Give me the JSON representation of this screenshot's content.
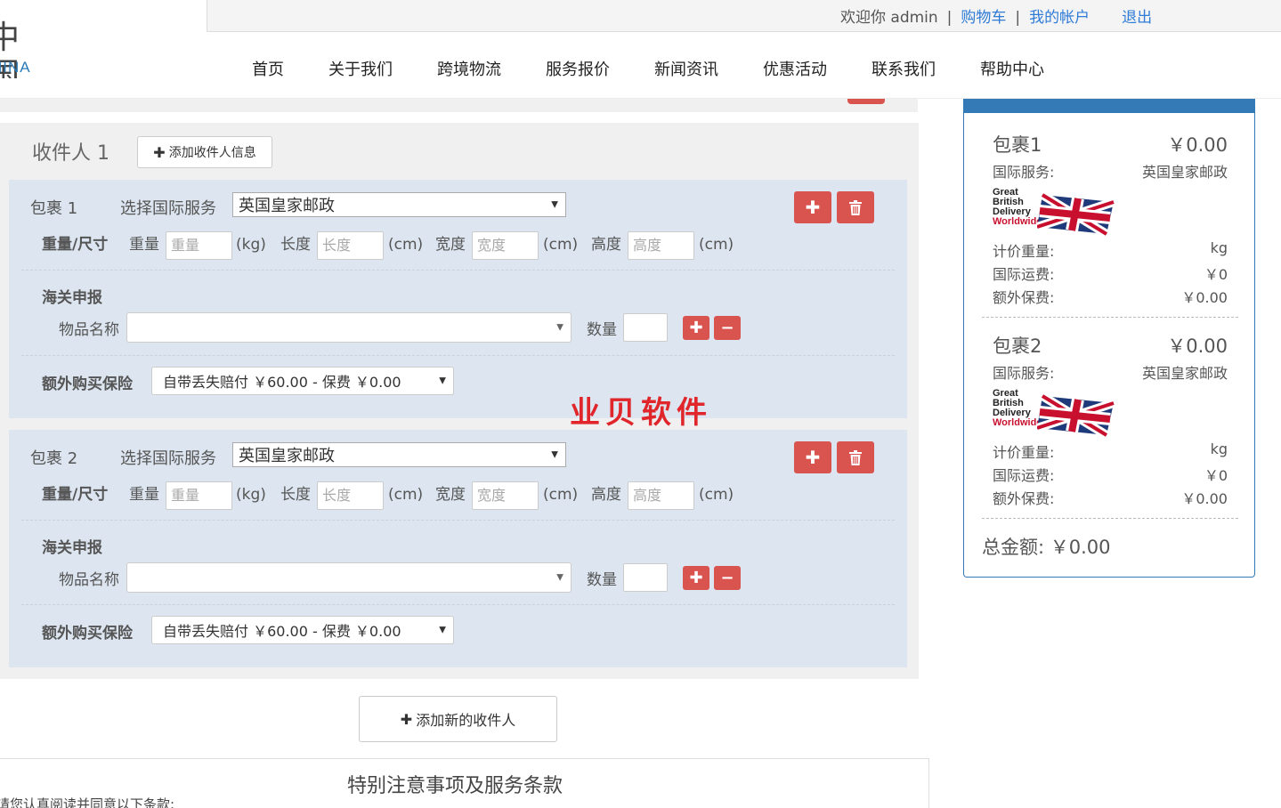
{
  "header": {
    "logo_cn": "中国",
    "logo_en": "HINA",
    "welcome": "欢迎你 admin",
    "cart": "购物车",
    "account": "我的帐户",
    "logout": "退出",
    "sep": "|"
  },
  "nav": [
    "首页",
    "关于我们",
    "跨境物流",
    "服务报价",
    "新闻资讯",
    "优惠活动",
    "联系我们",
    "帮助中心"
  ],
  "recipient": {
    "title": "收件人 1",
    "add_info_label": "添加收件人信息"
  },
  "form_labels": {
    "select_service": "选择国际服务",
    "weight_size": "重量/尺寸",
    "weight": "重量",
    "length": "长度",
    "width": "宽度",
    "height": "高度",
    "unit_kg": "(kg)",
    "unit_cm": "(cm)",
    "customs": "海关申报",
    "item_name": "物品名称",
    "quantity": "数量",
    "insurance": "额外购买保险"
  },
  "placeholders": {
    "weight": "重量",
    "length": "长度",
    "width": "宽度",
    "height": "高度"
  },
  "packages": [
    {
      "title": "包裹 1",
      "service": "英国皇家邮政",
      "item_name": "",
      "quantity": "",
      "insurance": "自带丢失赔付 ￥60.00 - 保费 ￥0.00"
    },
    {
      "title": "包裹 2",
      "service": "英国皇家邮政",
      "item_name": "",
      "quantity": "",
      "insurance": "自带丢失赔付 ￥60.00 - 保费 ￥0.00"
    }
  ],
  "watermark": "业贝软件",
  "add_recipient_label": "添加新的收件人",
  "terms": {
    "title": "特别注意事项及服务条款",
    "subtitle": "请您认真阅读并同意以下条款:"
  },
  "summary": {
    "packages": [
      {
        "name": "包裹1",
        "price": "￥0.00",
        "service_label": "国际服务:",
        "service": "英国皇家邮政",
        "weight_label": "计价重量:",
        "weight": "kg",
        "shipping_label": "国际运费:",
        "shipping": "￥0",
        "insurance_label": "额外保费:",
        "insurance": "￥0.00"
      },
      {
        "name": "包裹2",
        "price": "￥0.00",
        "service_label": "国际服务:",
        "service": "英国皇家邮政",
        "weight_label": "计价重量:",
        "weight": "kg",
        "shipping_label": "国际运费:",
        "shipping": "￥0",
        "insurance_label": "额外保费:",
        "insurance": "￥0.00"
      }
    ],
    "carrier_logo_lines": [
      "Great",
      "British",
      "Delivery",
      "Worldwide"
    ],
    "total": "总金额: ￥0.00"
  },
  "colors": {
    "primary": "#337ab7",
    "danger": "#d9534f",
    "package_bg": "#dce5f0",
    "link": "#2f7bd6",
    "watermark": "#e0262b"
  }
}
